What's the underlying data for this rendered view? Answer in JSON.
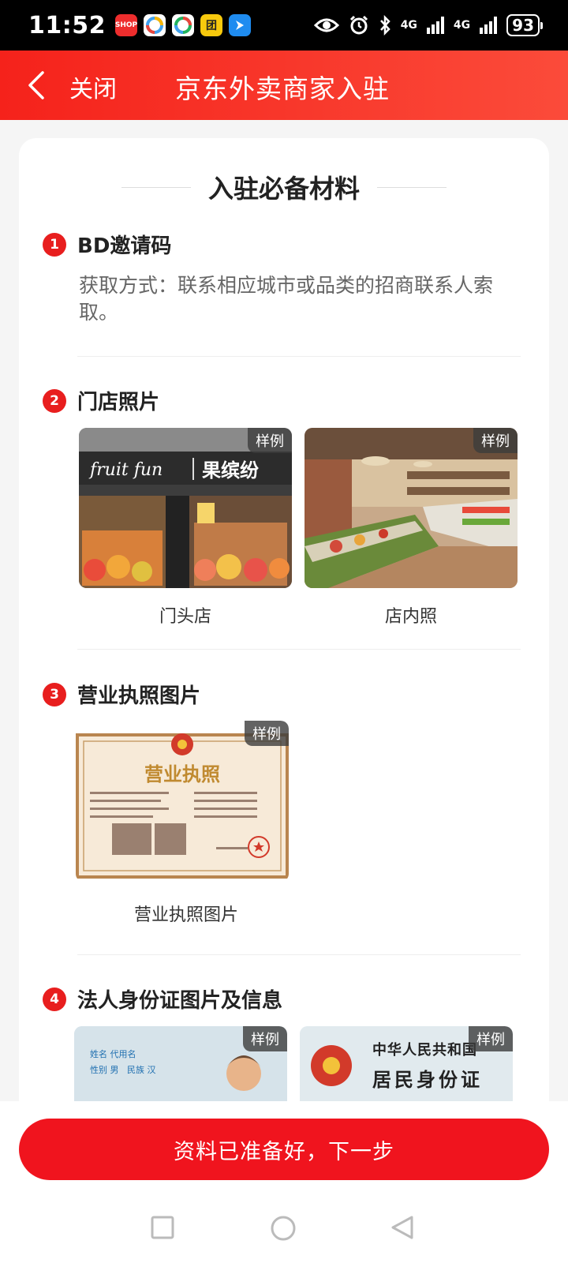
{
  "status_bar": {
    "time": "11:52",
    "battery": "93",
    "network_1": "4G",
    "network_2": "4G",
    "apps": [
      {
        "name": "shopping-app-icon",
        "color": "#ee2d2d",
        "label": "SHOP"
      },
      {
        "name": "colorful-app-icon",
        "color": "#ffffff",
        "label": ""
      },
      {
        "name": "colorful-app-icon-2",
        "color": "#ffffff",
        "label": ""
      },
      {
        "name": "meituan-app-icon",
        "color": "#f7c90d",
        "label": "团"
      },
      {
        "name": "blue-app-icon",
        "color": "#1f8cf0",
        "label": ""
      }
    ]
  },
  "header": {
    "close_label": "关闭",
    "title": "京东外卖商家入驻"
  },
  "content": {
    "section_title": "入驻必备材料",
    "items": [
      {
        "num": "1",
        "title": "BD邀请码",
        "desc": "获取方式：联系相应城市或品类的招商联系人索取。"
      },
      {
        "num": "2",
        "title": "门店照片",
        "photos": [
          {
            "caption": "门头店",
            "tag": "样例",
            "sign_en": "fruit fun",
            "sign_cn": "果缤纷"
          },
          {
            "caption": "店内照",
            "tag": "样例"
          }
        ]
      },
      {
        "num": "3",
        "title": "营业执照图片",
        "photos": [
          {
            "caption": "营业执照图片",
            "tag": "样例",
            "doc_title": "营业执照"
          }
        ]
      },
      {
        "num": "4",
        "title": "法人身份证图片及信息",
        "photos": [
          {
            "tag": "样例",
            "lines": [
              "姓名 代用名",
              "性别 男",
              "民族 汉"
            ]
          },
          {
            "tag": "样例",
            "lines": [
              "中华人民共和国",
              "居民身份证"
            ]
          }
        ]
      }
    ]
  },
  "bottom": {
    "next_button": "资料已准备好，下一步"
  },
  "colors": {
    "brand_red": "#f0141e",
    "header_red": "#f5221b"
  }
}
